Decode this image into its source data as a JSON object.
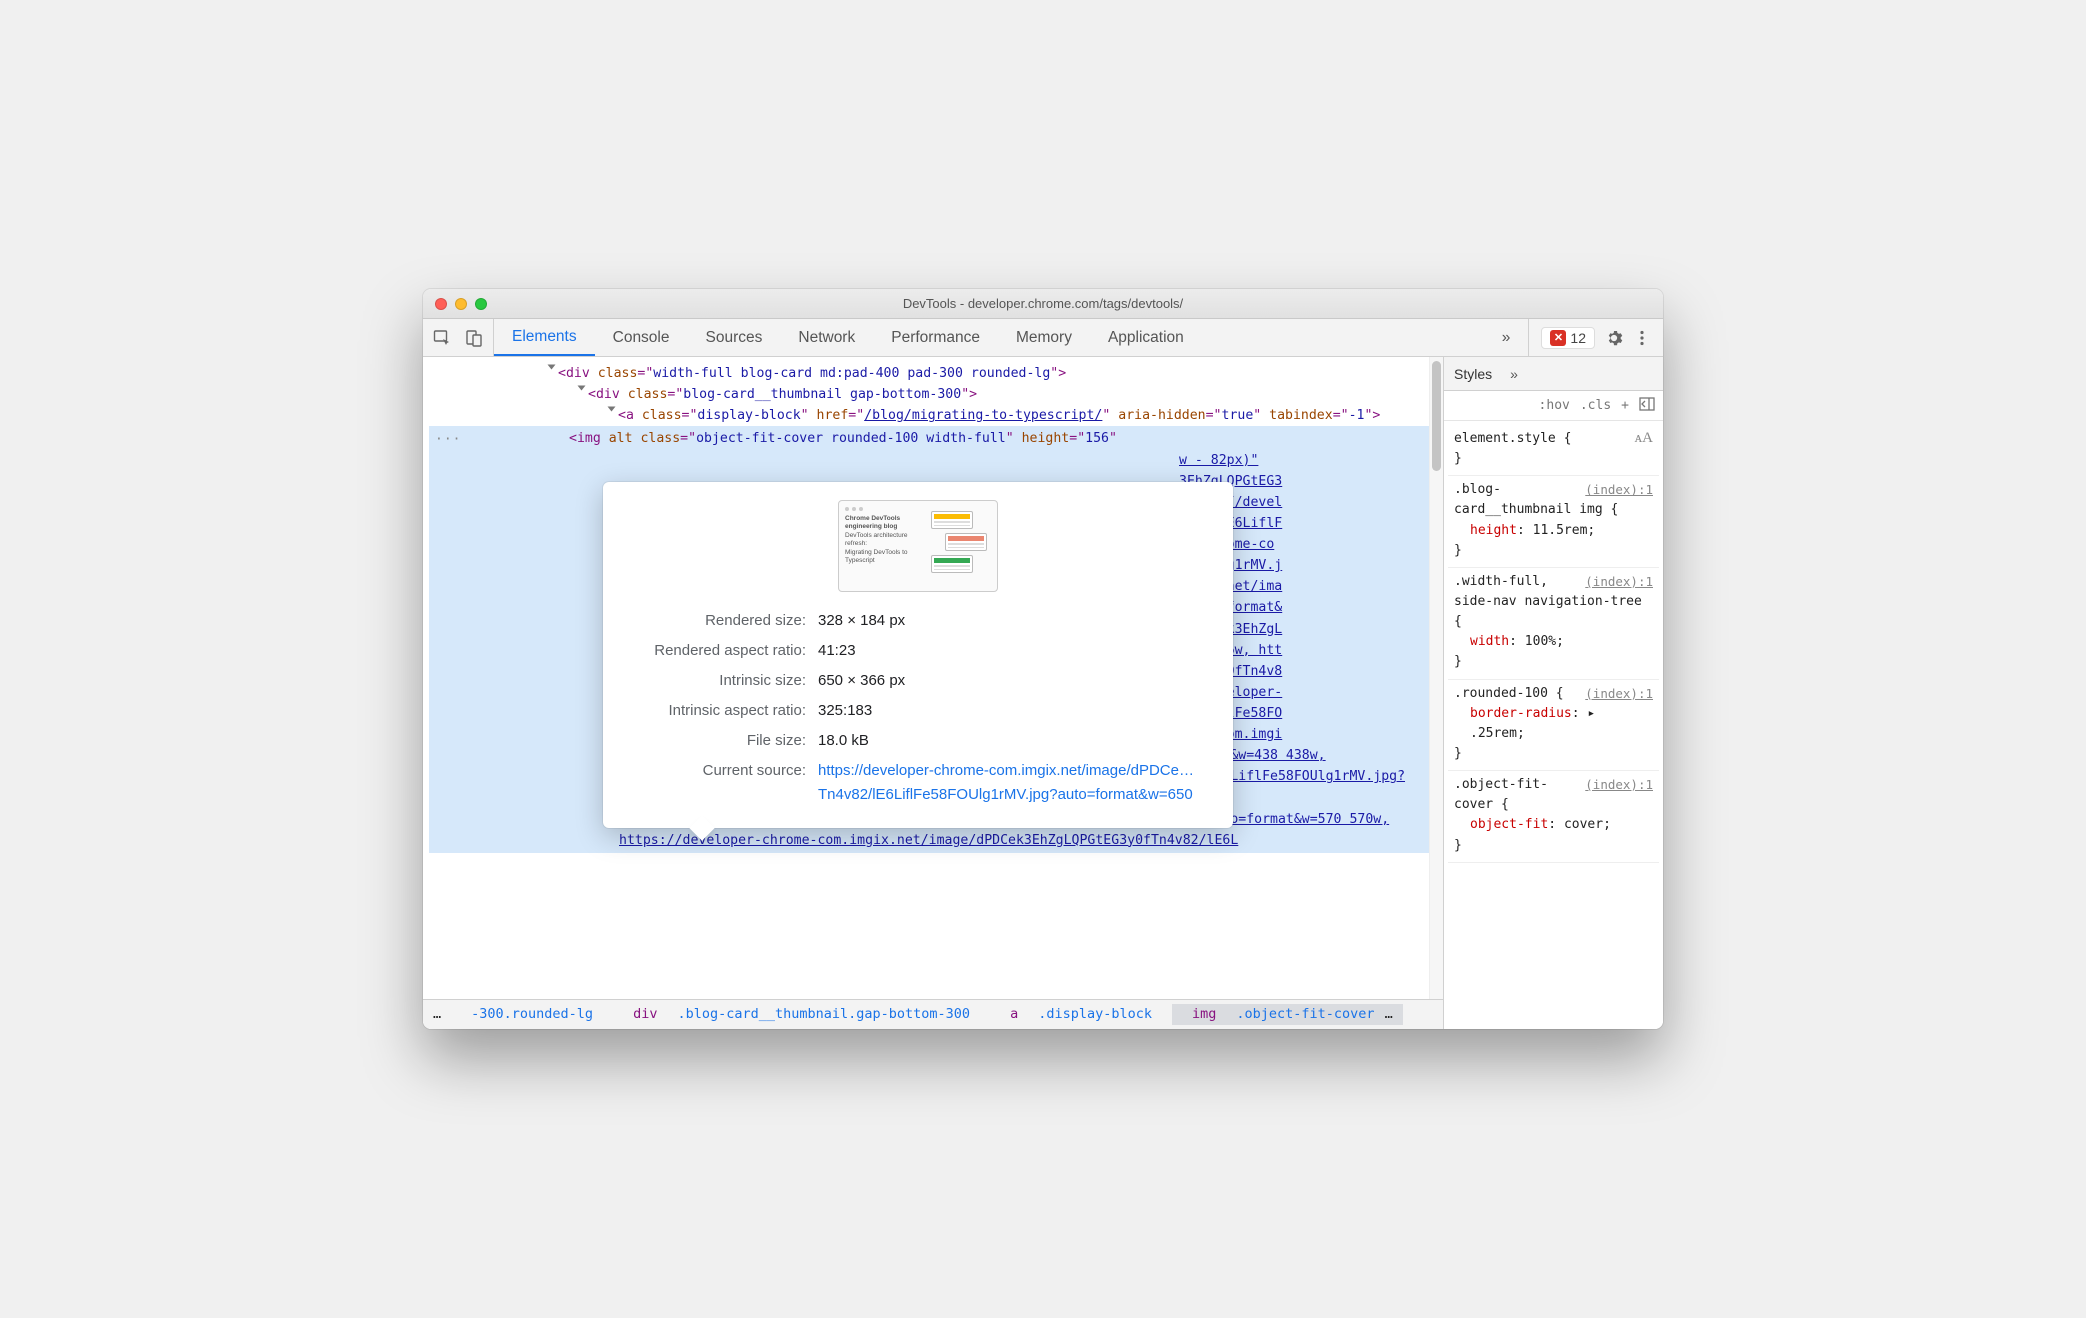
{
  "window": {
    "title": "DevTools - developer.chrome.com/tags/devtools/"
  },
  "toolbar": {
    "tabs": [
      "Elements",
      "Console",
      "Sources",
      "Network",
      "Performance",
      "Memory",
      "Application"
    ],
    "active_tab": 0,
    "more": "»",
    "error_count": "12"
  },
  "dom": {
    "rows": [
      {
        "indent": 0,
        "triangle": true,
        "parts": [
          {
            "t": "tag",
            "v": "<div "
          },
          {
            "t": "attr-n",
            "v": "class"
          },
          {
            "t": "tag",
            "v": "=\""
          },
          {
            "t": "attr-v",
            "v": "width-full blog-card md:pad-400 pad-300 rounded-lg"
          },
          {
            "t": "tag",
            "v": "\">"
          }
        ]
      },
      {
        "indent": 1,
        "triangle": true,
        "parts": [
          {
            "t": "tag",
            "v": "<div "
          },
          {
            "t": "attr-n",
            "v": "class"
          },
          {
            "t": "tag",
            "v": "=\""
          },
          {
            "t": "attr-v",
            "v": "blog-card__thumbnail gap-bottom-300"
          },
          {
            "t": "tag",
            "v": "\">"
          }
        ]
      },
      {
        "indent": 2,
        "triangle": true,
        "parts": [
          {
            "t": "tag",
            "v": "<a "
          },
          {
            "t": "attr-n",
            "v": "class"
          },
          {
            "t": "tag",
            "v": "=\""
          },
          {
            "t": "attr-v",
            "v": "display-block"
          },
          {
            "t": "tag",
            "v": "\" "
          },
          {
            "t": "attr-n",
            "v": "href"
          },
          {
            "t": "tag",
            "v": "=\""
          },
          {
            "t": "link",
            "v": "/blog/migrating-to-typescript/"
          },
          {
            "t": "tag",
            "v": "\" "
          },
          {
            "t": "attr-n",
            "v": "aria-hidden"
          },
          {
            "t": "tag",
            "v": "=\""
          },
          {
            "t": "attr-v",
            "v": "true"
          },
          {
            "t": "tag",
            "v": "\" "
          },
          {
            "t": "attr-n",
            "v": "tabindex"
          },
          {
            "t": "tag",
            "v": "=\""
          },
          {
            "t": "attr-v",
            "v": "-1"
          },
          {
            "t": "tag",
            "v": "\">"
          }
        ]
      }
    ],
    "selected": {
      "marker": "···",
      "prefix_parts": [
        {
          "t": "tag",
          "v": "<img "
        },
        {
          "t": "attr-n",
          "v": "alt "
        },
        {
          "t": "attr-n",
          "v": "class"
        },
        {
          "t": "tag",
          "v": "=\""
        },
        {
          "t": "attr-v",
          "v": "object-fit-cover rounded-100 width-full"
        },
        {
          "t": "tag",
          "v": "\" "
        },
        {
          "t": "attr-n",
          "v": "height"
        },
        {
          "t": "tag",
          "v": "=\""
        },
        {
          "t": "attr-v",
          "v": "156"
        },
        {
          "t": "tag",
          "v": "\""
        }
      ],
      "frag_right": [
        "w - 82px)\"",
        "3EhZgLQPGtEG3",
        "https://devel",
        "4v82/lE6LiflF",
        "er-chrome-co",
        "58FOUlg1rMV.j",
        "imgix.net/ima",
        "?auto=format&",
        "/dPDCek3EhZgL",
        "296 296w, htt",
        "GtEG3y0fTn4v8",
        "://developer-",
        "lE6LiflFe58FO",
        "rome-com.imgi"
      ],
      "tail": "x.net/image/dPDCek3EhZgLQPGtEG3y0fTn4v82/lE6LiflFe58FOUlg1rMV.jpg?auto=format&w=438 438w, https://developer-chrome-com.imgix.net/image/dPDCek3EhZgLQPGtEG3y0fTn4v82/lE6LiflFe58FOUlg1rMV.jpg?auto=format&w=500 500w, https://developer-chrome-com.imgix.net/image/dPDCek3EhZgLQPGtEG3y0fTn4v82/lE6LiflFe58FOUlg1rMV.jpg?auto=format&w=570 570w, https://developer-chrome-com.imgix.net/image/dPDCek3EhZgLQPGtEG3y0fTn4v82/lE6L"
    }
  },
  "tooltip": {
    "thumb": {
      "line1": "Chrome DevTools engineering blog",
      "line2": "DevTools architecture refresh:",
      "line3": "Migrating DevTools to Typescript"
    },
    "rows": [
      {
        "label": "Rendered size:",
        "value": "328 × 184 px"
      },
      {
        "label": "Rendered aspect ratio:",
        "value": "41:23"
      },
      {
        "label": "Intrinsic size:",
        "value": "650 × 366 px"
      },
      {
        "label": "Intrinsic aspect ratio:",
        "value": "325:183"
      },
      {
        "label": "File size:",
        "value": "18.0 kB"
      },
      {
        "label": "Current source:",
        "value": "https://developer-chrome-com.imgix.net/image/dPDCe…Tn4v82/lE6LiflFe58FOUlg1rMV.jpg?auto=format&w=650",
        "link": true
      }
    ]
  },
  "breadcrumb": {
    "more": "…",
    "items": [
      {
        "cls": "-300.rounded-lg"
      },
      {
        "tag": "div",
        "cls": ".blog-card__thumbnail.gap-bottom-300"
      },
      {
        "tag": "a",
        "cls": ".display-block"
      },
      {
        "tag": "img",
        "cls": ".object-fit-cover",
        "selected": true,
        "truncated": true
      }
    ]
  },
  "styles": {
    "tab": "Styles",
    "more": "»",
    "bar": {
      "hov": ":hov",
      "cls": ".cls",
      "plus": "+"
    },
    "font_icon": "ᴀA",
    "rules": [
      {
        "selector": "element.style",
        "origin": "",
        "decls": []
      },
      {
        "selector": ".blog-card__thumbnail img",
        "origin": "(index):1",
        "decls": [
          {
            "prop": "height",
            "val": "11.5rem;"
          }
        ]
      },
      {
        "selector": ".width-full, side-nav navigation-tree",
        "origin": "(index):1",
        "decls": [
          {
            "prop": "width",
            "val": "100%;"
          }
        ]
      },
      {
        "selector": ".rounded-100",
        "origin": "(index):1",
        "decls": [
          {
            "prop": "border-radius",
            "val": "▸ .25rem;"
          }
        ]
      },
      {
        "selector": ".object-fit-cover",
        "origin": "(index):1",
        "decls": [
          {
            "prop": "object-fit",
            "val": "cover;"
          }
        ]
      }
    ]
  }
}
